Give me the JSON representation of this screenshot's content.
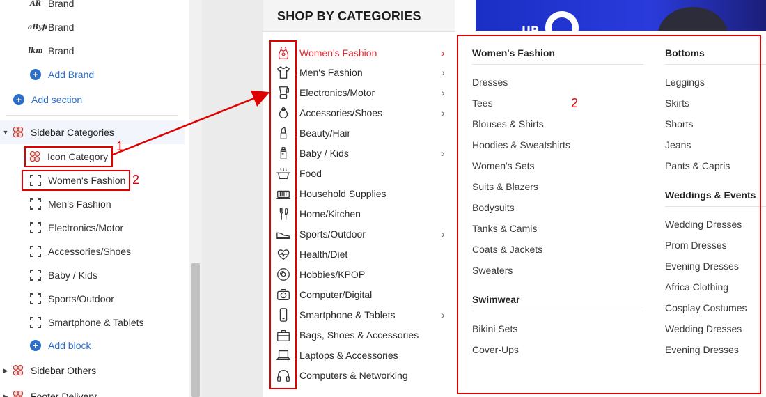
{
  "editor": {
    "brand_items": [
      {
        "logo_text": "AR",
        "label": "Brand"
      },
      {
        "logo_text": "aByfi",
        "label": "Brand"
      },
      {
        "logo_text": "lkm",
        "label": "Brand"
      }
    ],
    "add_brand_label": "Add Brand",
    "add_section_label": "Add section",
    "sidebar_categories": {
      "label": "Sidebar Categories",
      "icon_block_label": "Icon Category",
      "blocks": [
        "Women's Fashion",
        "Men's Fashion",
        "Electronics/Motor",
        "Accessories/Shoes",
        "Baby / Kids",
        "Sports/Outdoor",
        "Smartphone & Tablets"
      ],
      "add_block_label": "Add block"
    },
    "sidebar_others_label": "Sidebar Others",
    "footer_delivery_label": "Footer Delivery"
  },
  "shop": {
    "title": "SHOP BY CATEGORIES",
    "categories": [
      {
        "label": "Women's Fashion",
        "icon": "dress-icon",
        "has_submenu": true,
        "active": true
      },
      {
        "label": "Men's Fashion",
        "icon": "shirt-icon",
        "has_submenu": true
      },
      {
        "label": "Electronics/Motor",
        "icon": "blender-icon",
        "has_submenu": true
      },
      {
        "label": "Accessories/Shoes",
        "icon": "ring-icon",
        "has_submenu": true
      },
      {
        "label": "Beauty/Hair",
        "icon": "lipstick-icon",
        "has_submenu": false
      },
      {
        "label": "Baby / Kids",
        "icon": "baby-bottle-icon",
        "has_submenu": true
      },
      {
        "label": "Food",
        "icon": "pot-icon",
        "has_submenu": false
      },
      {
        "label": "Household Supplies",
        "icon": "heater-icon",
        "has_submenu": false
      },
      {
        "label": "Home/Kitchen",
        "icon": "utensils-icon",
        "has_submenu": false
      },
      {
        "label": "Sports/Outdoor",
        "icon": "sneaker-icon",
        "has_submenu": true
      },
      {
        "label": "Health/Diet",
        "icon": "heart-pulse-icon",
        "has_submenu": false
      },
      {
        "label": "Hobbies/KPOP",
        "icon": "vinyl-icon",
        "has_submenu": false
      },
      {
        "label": "Computer/Digital",
        "icon": "camera-icon",
        "has_submenu": false
      },
      {
        "label": "Smartphone & Tablets",
        "icon": "phone-icon",
        "has_submenu": true
      },
      {
        "label": "Bags, Shoes & Accessories",
        "icon": "bag-icon",
        "has_submenu": false
      },
      {
        "label": "Laptops & Accessories",
        "icon": "laptop-icon",
        "has_submenu": false
      },
      {
        "label": "Computers & Networking",
        "icon": "headphones-icon",
        "has_submenu": false
      }
    ]
  },
  "mega_menu": {
    "columns": [
      {
        "groups": [
          {
            "heading": "Women's Fashion",
            "items": [
              "Dresses",
              "Tees",
              "Blouses & Shirts",
              "Hoodies & Sweatshirts",
              "Women's Sets",
              "Suits & Blazers",
              "Bodysuits",
              "Tanks & Camis",
              "Coats & Jackets",
              "Sweaters"
            ]
          },
          {
            "heading": "Swimwear",
            "items": [
              "Bikini Sets",
              "Cover-Ups"
            ]
          }
        ]
      },
      {
        "groups": [
          {
            "heading": "Bottoms",
            "items": [
              "Leggings",
              "Skirts",
              "Shorts",
              "Jeans",
              "Pants & Capris"
            ]
          },
          {
            "heading": "Weddings & Events",
            "items": [
              "Wedding Dresses",
              "Prom Dresses",
              "Evening Dresses",
              "Africa Clothing",
              "Cosplay Costumes",
              "Wedding Dresses",
              "Evening Dresses"
            ]
          }
        ]
      }
    ]
  },
  "banner": {
    "text": "UP"
  },
  "annotations": {
    "num_1": "1",
    "num_2": "2",
    "num_2b": "2"
  },
  "colors": {
    "accent_red": "#e3262e",
    "link_blue": "#2c6ecb",
    "annotation_red": "#e00000"
  }
}
